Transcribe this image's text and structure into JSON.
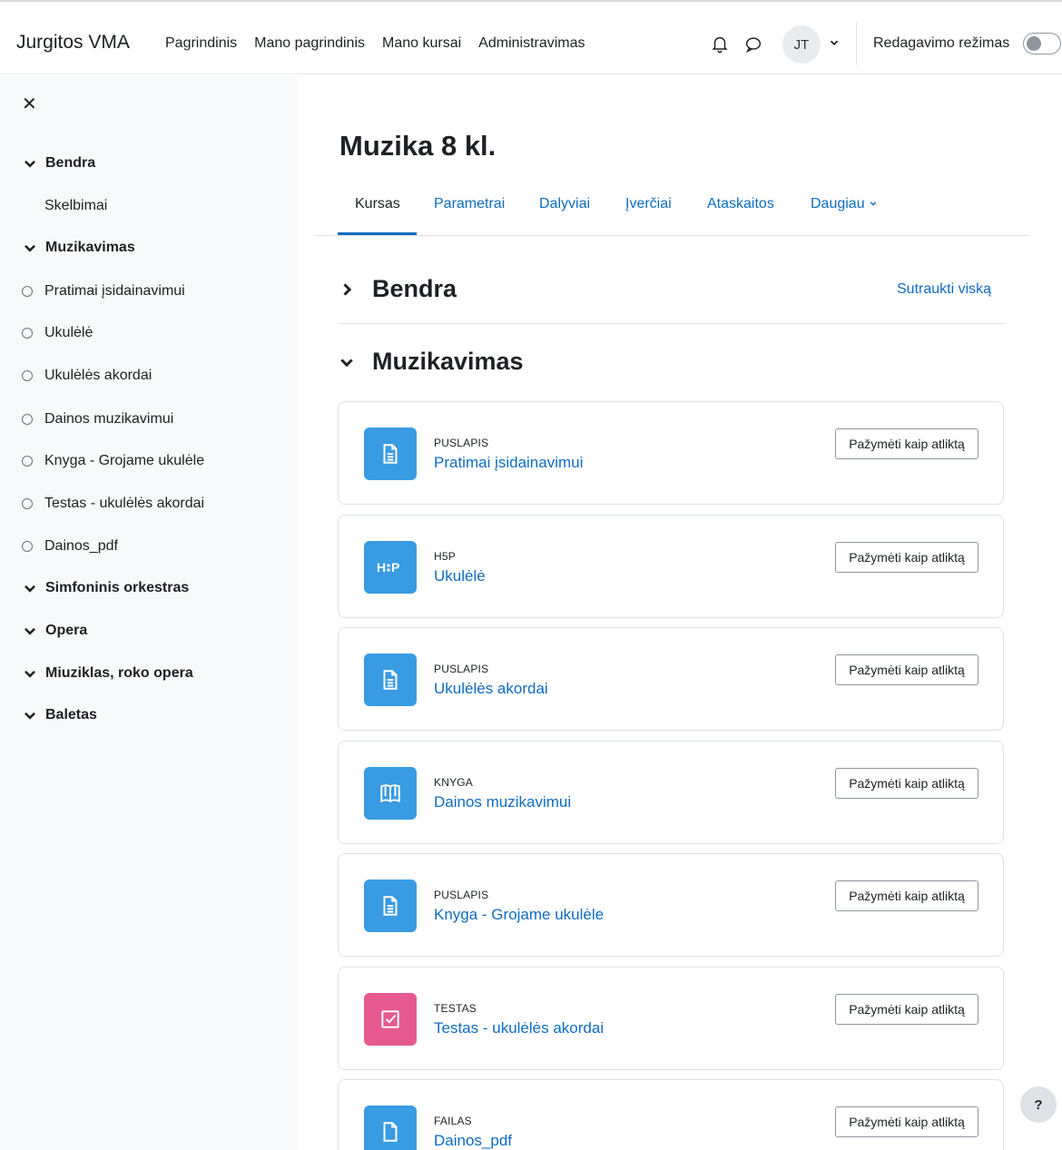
{
  "header": {
    "brand": "Jurgitos VMA",
    "nav": [
      "Pagrindinis",
      "Mano pagrindinis",
      "Mano kursai",
      "Administravimas"
    ],
    "avatar_initials": "JT",
    "edit_mode_label": "Redagavimo režimas",
    "edit_mode_on": false
  },
  "drawer": {
    "close_icon": "close-icon",
    "items": [
      {
        "label": "Bendra",
        "kind": "section"
      },
      {
        "label": "Skelbimai",
        "kind": "sub"
      },
      {
        "label": "Muzikavimas",
        "kind": "section"
      },
      {
        "label": "Pratimai įsidainavimui",
        "kind": "activity"
      },
      {
        "label": "Ukulėlė",
        "kind": "activity"
      },
      {
        "label": "Ukulėlės akordai",
        "kind": "activity"
      },
      {
        "label": "Dainos muzikavimui",
        "kind": "activity"
      },
      {
        "label": "Knyga - Grojame ukulėle",
        "kind": "activity"
      },
      {
        "label": "Testas - ukulėlės akordai",
        "kind": "activity"
      },
      {
        "label": "Dainos_pdf",
        "kind": "activity"
      },
      {
        "label": "Simfoninis orkestras",
        "kind": "section"
      },
      {
        "label": "Opera",
        "kind": "section"
      },
      {
        "label": "Miuziklas, roko opera",
        "kind": "section"
      },
      {
        "label": "Baletas",
        "kind": "section"
      }
    ]
  },
  "course": {
    "title": "Muzika 8 kl.",
    "tabs": [
      "Kursas",
      "Parametrai",
      "Dalyviai",
      "Įverčiai",
      "Ataskaitos",
      "Daugiau"
    ],
    "active_tab": "Kursas",
    "collapse_all": "Sutraukti viską",
    "sections": [
      {
        "name": "Bendra",
        "expanded": false
      },
      {
        "name": "Muzikavimas",
        "expanded": true
      }
    ],
    "activities": [
      {
        "type": "PUSLAPIS",
        "name": "Pratimai įsidainavimui",
        "icon": "page-icon",
        "color": "#399be2"
      },
      {
        "type": "H5P",
        "name": "Ukulėlė",
        "icon": "h5p-icon",
        "color": "#399be2"
      },
      {
        "type": "PUSLAPIS",
        "name": "Ukulėlės akordai",
        "icon": "page-icon",
        "color": "#399be2"
      },
      {
        "type": "KNYGA",
        "name": "Dainos muzikavimui",
        "icon": "book-icon",
        "color": "#399be2"
      },
      {
        "type": "PUSLAPIS",
        "name": "Knyga - Grojame ukulėle",
        "icon": "page-icon",
        "color": "#399be2"
      },
      {
        "type": "TESTAS",
        "name": "Testas - ukulėlės akordai",
        "icon": "quiz-icon",
        "color": "#e6598f"
      },
      {
        "type": "FAILAS",
        "name": "Dainos_pdf",
        "icon": "file-icon",
        "color": "#399be2"
      }
    ],
    "mark_done_label": "Pažymėti kaip atliktą"
  },
  "help": {
    "label": "?"
  },
  "colors": {
    "link": "#0f6cbf",
    "drawer_bg": "#f8f9fa",
    "border": "#dee2e6"
  }
}
